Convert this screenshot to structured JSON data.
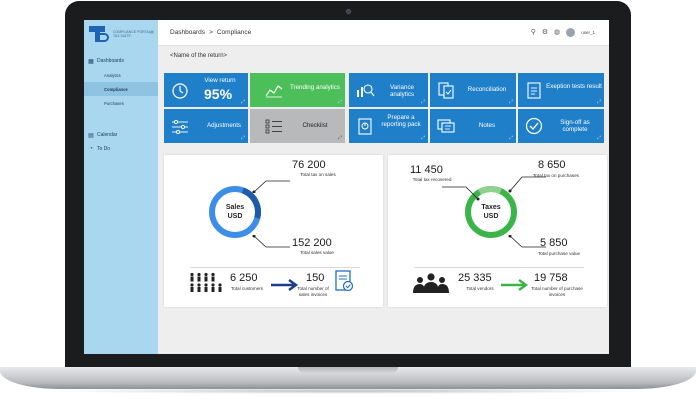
{
  "app": {
    "logo_text": "COMPLIANCE PORTAL TAX SUITE",
    "collapse": "«"
  },
  "sidebar": {
    "items": [
      {
        "label": "Dashboards",
        "icon": "dashboard-icon",
        "sub": false,
        "active": false
      },
      {
        "label": "Analytics",
        "icon": "",
        "sub": true,
        "active": false
      },
      {
        "label": "Compliance",
        "icon": "",
        "sub": true,
        "active": true
      },
      {
        "label": "Purchases",
        "icon": "",
        "sub": true,
        "active": false
      },
      {
        "label": "Calendar",
        "icon": "calendar-icon",
        "sub": false,
        "active": false
      },
      {
        "label": "To Do",
        "icon": "clock-icon",
        "sub": false,
        "active": false
      }
    ]
  },
  "header": {
    "crumb_1": "Dashboards",
    "crumb_sep": ">",
    "crumb_2": "Compliance",
    "user": "user_1"
  },
  "return_name": "<Name of the return>",
  "tiles": {
    "view_return": "View return",
    "view_return_pct": "95%",
    "trending": "Trending analytics",
    "variance": "Variance analytics",
    "reconciliation": "Reconciliation",
    "exception": "Exeption tests result",
    "adjustments": "Adjustments",
    "checklist": "Checklist",
    "reporting_pack": "Prepare a reporting pack",
    "notes": "Notes",
    "signoff": "Sign-off as complete"
  },
  "sales": {
    "ring_label_1": "Sales",
    "ring_label_2": "USD",
    "tax_value": "76 200",
    "tax_label": "Total tax on sales",
    "sales_value": "152 200",
    "sales_label": "Total sales value",
    "customers_value": "6 250",
    "customers_label": "Total customers",
    "invoices_value": "150",
    "invoices_label": "Total number of sales invoices"
  },
  "taxes": {
    "ring_label_1": "Taxes",
    "ring_label_2": "USD",
    "recovered_value": "11 450",
    "recovered_label": "Total tax recovered",
    "purchase_tax_value": "8 650",
    "purchase_tax_label": "Total tax on purchases",
    "purchase_value": "5 850",
    "purchase_label": "Total purchase value",
    "vendors_value": "25 335",
    "vendors_label": "Total vendors",
    "purchase_invoices_value": "19 758",
    "purchase_invoices_label": "Total number of purchase invoices"
  },
  "colors": {
    "tile_blue": "#1f7fc8",
    "tile_green": "#4cbf5a",
    "tile_grey": "#b7b9bb",
    "sales_ring": "#3d8ee6",
    "tax_ring": "#3bb54a"
  }
}
